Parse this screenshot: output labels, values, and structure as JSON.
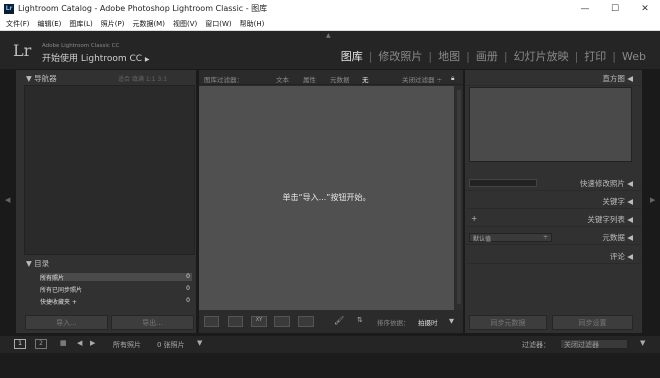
{
  "window": {
    "title": "Lightroom Catalog - Adobe Photoshop Lightroom Classic - 图库",
    "icon": "Lr"
  },
  "menu": [
    "文件(F)",
    "编辑(E)",
    "图库(L)",
    "照片(P)",
    "元数据(M)",
    "视图(V)",
    "窗口(W)",
    "帮助(H)"
  ],
  "identity": {
    "logo": "Lr",
    "line1": "Adobe Lightroom Classic CC",
    "line2": "开始使用 Lightroom CC"
  },
  "modules": [
    "图库",
    "修改照片",
    "地图",
    "画册",
    "幻灯片放映",
    "打印",
    "Web"
  ],
  "left": {
    "navigator": "导航器",
    "nav_options": "适合 填满 1:1 3:1",
    "catalog": "目录",
    "catalog_items": [
      {
        "label": "所有照片",
        "count": "0"
      },
      {
        "label": "所有已同步照片",
        "count": "0"
      },
      {
        "label": "快捷收藏夹 +",
        "count": "0"
      }
    ],
    "import_btn": "导入...",
    "export_btn": "导出..."
  },
  "filter": {
    "label": "图库过滤器：",
    "options": [
      "文本",
      "属性",
      "元数据",
      "无"
    ],
    "preset": "关闭过滤器 ÷"
  },
  "grid": {
    "message": "单击“导入...”按钮开始。"
  },
  "toolbar": {
    "sort_label": "排序依据：",
    "sort_value": "拍摄时"
  },
  "right": {
    "histogram": "直方图",
    "quick_develop": "快速修改照片",
    "keywording": "关键字",
    "keyword_list": "关键字列表",
    "metadata": "元数据",
    "metadata_preset": "默认值",
    "comments": "评论",
    "sync_meta_btn": "同步元数据",
    "sync_settings_btn": "同步设置"
  },
  "filmstrip": {
    "source": "所有照片",
    "count": "0 张照片",
    "filter_label": "过滤器：",
    "filter_value": "关闭过滤器"
  }
}
